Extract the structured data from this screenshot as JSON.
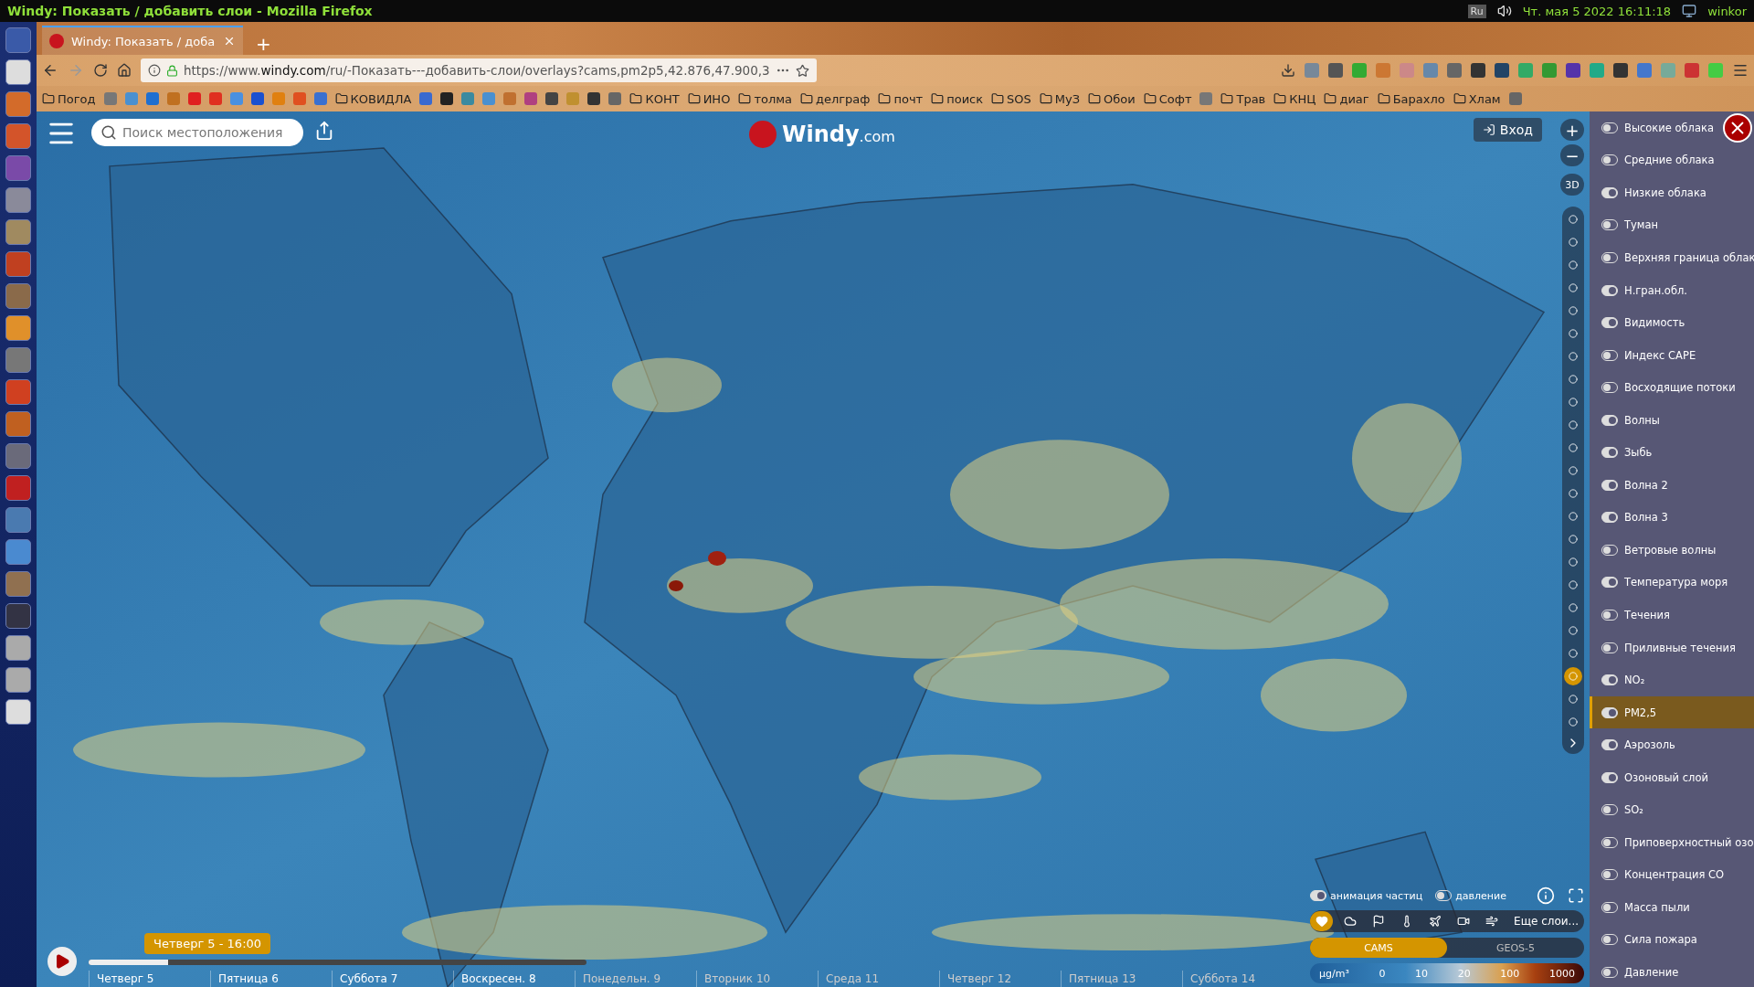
{
  "window": {
    "title": "Windy: Показать / добавить слои - Mozilla Firefox"
  },
  "system_tray": {
    "keyboard": "Ru",
    "clock": "Чт. мая  5 2022 16:11:18",
    "user": "winkor"
  },
  "tabs": [
    {
      "label": "Windy: Показать / доба",
      "selected": true
    }
  ],
  "new_tab": "+",
  "address_bar": {
    "prefix": "https://www.",
    "domain": "windy.com",
    "path": "/ru/-Показать---добавить-слои/overlays?cams,pm2p5,42.876,47.900,3"
  },
  "bookmarks": [
    {
      "kind": "folder",
      "label": "Погод"
    },
    {
      "kind": "icon"
    },
    {
      "kind": "icon"
    },
    {
      "kind": "icon"
    },
    {
      "kind": "icon"
    },
    {
      "kind": "icon"
    },
    {
      "kind": "icon"
    },
    {
      "kind": "icon"
    },
    {
      "kind": "icon"
    },
    {
      "kind": "icon"
    },
    {
      "kind": "icon"
    },
    {
      "kind": "icon"
    },
    {
      "kind": "folder",
      "label": "КОВИДЛА"
    },
    {
      "kind": "icon"
    },
    {
      "kind": "icon"
    },
    {
      "kind": "icon"
    },
    {
      "kind": "icon"
    },
    {
      "kind": "icon"
    },
    {
      "kind": "icon"
    },
    {
      "kind": "icon"
    },
    {
      "kind": "icon"
    },
    {
      "kind": "icon"
    },
    {
      "kind": "icon"
    },
    {
      "kind": "folder",
      "label": "КОНТ"
    },
    {
      "kind": "folder",
      "label": "ИНО"
    },
    {
      "kind": "folder",
      "label": "толма"
    },
    {
      "kind": "folder",
      "label": "делграф"
    },
    {
      "kind": "folder",
      "label": "почт"
    },
    {
      "kind": "folder",
      "label": "поиск"
    },
    {
      "kind": "folder",
      "label": "SOS"
    },
    {
      "kind": "folder",
      "label": "МуЗ"
    },
    {
      "kind": "folder",
      "label": "Обои"
    },
    {
      "kind": "folder",
      "label": "Софт"
    },
    {
      "kind": "icon"
    },
    {
      "kind": "folder",
      "label": "Трав"
    },
    {
      "kind": "folder",
      "label": "КНЦ"
    },
    {
      "kind": "folder",
      "label": "диаг"
    },
    {
      "kind": "folder",
      "label": "Барахло"
    },
    {
      "kind": "folder",
      "label": "Хлам"
    },
    {
      "kind": "icon"
    }
  ],
  "map": {
    "search": {
      "placeholder": "Поиск местоположения"
    },
    "logo": {
      "name": "Windy",
      "suffix": ".com"
    },
    "login": "Вход",
    "zoom_in": "+",
    "zoom_out": "−",
    "view_3d": "3D",
    "rail": [
      {
        "selected": false
      },
      {
        "selected": false
      },
      {
        "selected": false
      },
      {
        "selected": false
      },
      {
        "selected": false
      },
      {
        "selected": false
      },
      {
        "selected": false
      },
      {
        "selected": false
      },
      {
        "selected": false
      },
      {
        "selected": false
      },
      {
        "selected": false
      },
      {
        "selected": false
      },
      {
        "selected": false
      },
      {
        "selected": false
      },
      {
        "selected": false
      },
      {
        "selected": false
      },
      {
        "selected": false
      },
      {
        "selected": false
      },
      {
        "selected": false
      },
      {
        "selected": false
      },
      {
        "selected": true
      },
      {
        "selected": false
      },
      {
        "selected": false
      }
    ],
    "toggles": [
      {
        "label": "анимация частиц",
        "on": true
      },
      {
        "label": "давление",
        "on": false
      }
    ],
    "quick_layers": [
      {
        "selected": true
      },
      {
        "selected": false
      },
      {
        "selected": false
      },
      {
        "selected": false
      },
      {
        "selected": false
      },
      {
        "selected": false
      },
      {
        "selected": false
      }
    ],
    "more_layers": "Еще слои...",
    "models": [
      {
        "label": "CAMS",
        "selected": true
      },
      {
        "label": "GEOS-5",
        "selected": false
      }
    ],
    "legend": {
      "unit": "µg/m³",
      "ticks": [
        "0",
        "10",
        "20",
        "100",
        "1000"
      ]
    },
    "timeline": {
      "tooltip": "Четверг 5 - 16:00",
      "level": 0.16,
      "days": [
        "Четверг 5",
        "Пятница 6",
        "Суббота 7",
        "Воскресен. 8",
        "Понедельн. 9",
        "Вторник 10",
        "Среда 11",
        "Четверг 12",
        "Пятница 13",
        "Суббота 14"
      ]
    }
  },
  "layers": [
    {
      "label": "Высокие облака",
      "on": false,
      "selected": false
    },
    {
      "label": "Средние облака",
      "on": false,
      "selected": false
    },
    {
      "label": "Низкие облака",
      "on": true,
      "selected": false
    },
    {
      "label": "Туман",
      "on": false,
      "selected": false
    },
    {
      "label": "Верхняя граница облак",
      "on": false,
      "selected": false
    },
    {
      "label": "Н.гран.обл.",
      "on": true,
      "selected": false
    },
    {
      "label": "Видимость",
      "on": true,
      "selected": false
    },
    {
      "label": "Индекс CAPE",
      "on": false,
      "selected": false
    },
    {
      "label": "Восходящие потоки",
      "on": false,
      "selected": false
    },
    {
      "label": "Волны",
      "on": true,
      "selected": false
    },
    {
      "label": "Зыбь",
      "on": true,
      "selected": false
    },
    {
      "label": "Волна 2",
      "on": true,
      "selected": false
    },
    {
      "label": "Волна 3",
      "on": true,
      "selected": false
    },
    {
      "label": "Ветровые волны",
      "on": false,
      "selected": false
    },
    {
      "label": "Температура моря",
      "on": true,
      "selected": false
    },
    {
      "label": "Течения",
      "on": false,
      "selected": false
    },
    {
      "label": "Приливные течения",
      "on": false,
      "selected": false
    },
    {
      "label": "NO₂",
      "on": true,
      "selected": false
    },
    {
      "label": "PM2,5",
      "on": true,
      "selected": true
    },
    {
      "label": "Аэрозоль",
      "on": true,
      "selected": false
    },
    {
      "label": "Озоновый слой",
      "on": true,
      "selected": false
    },
    {
      "label": "SO₂",
      "on": false,
      "selected": false
    },
    {
      "label": "Приповерхностный озо",
      "on": false,
      "selected": false
    },
    {
      "label": "Концентрация CO",
      "on": false,
      "selected": false
    },
    {
      "label": "Масса пыли",
      "on": false,
      "selected": false
    },
    {
      "label": "Сила пожара",
      "on": false,
      "selected": false
    },
    {
      "label": "Давление",
      "on": false,
      "selected": false
    }
  ]
}
